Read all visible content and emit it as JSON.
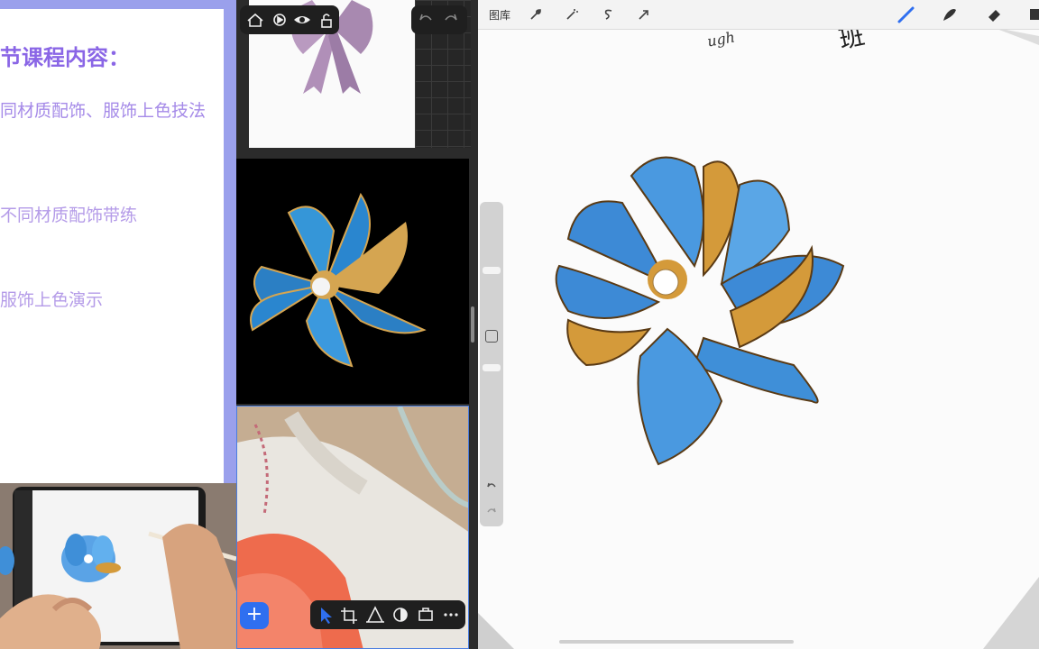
{
  "slide": {
    "title": "节课程内容：",
    "line1": "同材质配饰、服饰上色技法",
    "line2": "不同材质配饰带练",
    "line3": "服饰上色演示"
  },
  "reference_toolbar": {
    "icons": [
      "home-icon",
      "play-icon",
      "eye-icon",
      "unlock-icon"
    ],
    "undo_icons": [
      "undo-icon",
      "redo-icon"
    ]
  },
  "bottom_toolbar": {
    "add_label": "+",
    "icons": [
      "select-arrow-icon",
      "crop-icon",
      "perspective-icon",
      "adjust-icon",
      "briefcase-icon",
      "more-icon"
    ]
  },
  "canvas": {
    "gallery_label": "图库",
    "top_text_fragment": "ugh",
    "top_text_cn": "班",
    "left_tools": [
      "wrench-icon",
      "magic-wand-icon",
      "selection-s-icon",
      "transform-arrow-icon"
    ],
    "right_tools": [
      "brush-icon",
      "smudge-icon",
      "eraser-icon",
      "layers-icon"
    ],
    "side_icons": [
      "square-modify-icon",
      "undo-side-icon",
      "redo-side-icon"
    ]
  },
  "colors": {
    "slide_border": "#9aa0ec",
    "title_purple": "#8a66e6",
    "accent_blue": "#2f6ff0",
    "petal_blue": "#3d8ad6",
    "gold": "#d49a3a"
  }
}
